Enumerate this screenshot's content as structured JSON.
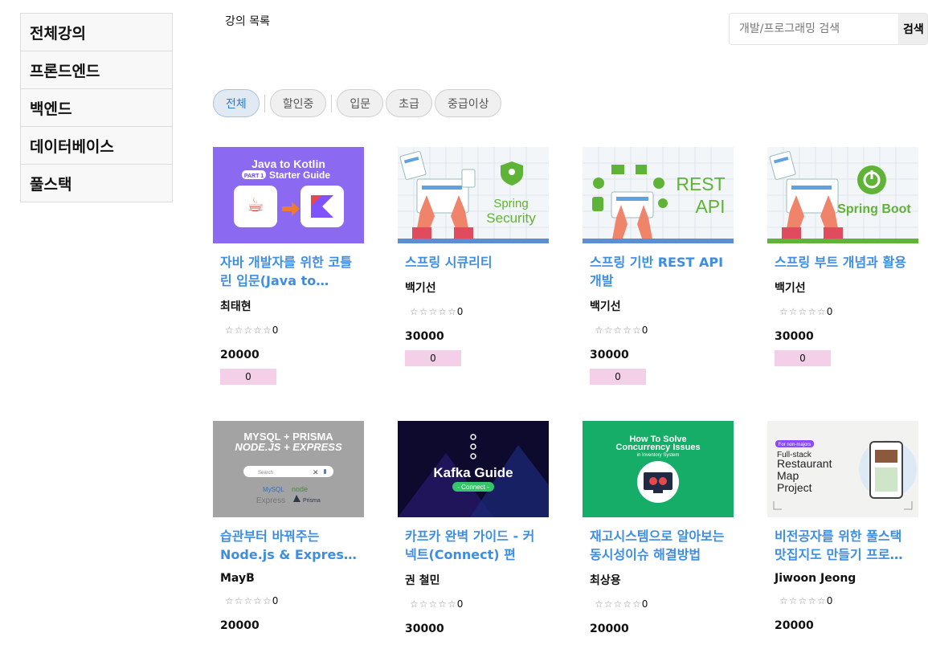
{
  "sidebar": {
    "items": [
      {
        "label": "전체강의"
      },
      {
        "label": "프론드엔드"
      },
      {
        "label": "백엔드"
      },
      {
        "label": "데이터베이스"
      },
      {
        "label": "풀스택"
      }
    ]
  },
  "page_heading": "강의 목록",
  "search": {
    "placeholder": "개발/프로그래밍 검색",
    "button_label": "검색"
  },
  "filters": [
    {
      "label": "전체",
      "active": true
    },
    {
      "label": "할인중"
    },
    {
      "label": "입문"
    },
    {
      "label": "초급"
    },
    {
      "label": "중급이상"
    }
  ],
  "courses": [
    {
      "title": "자바 개발자를 위한 코틀린 입문(Java to Kotlin Starter Guide)",
      "author": "최태현",
      "rating_count": "0",
      "price": "20000",
      "discount": "0",
      "thumb": {
        "line1": "Java to Kotlin",
        "part": "PART 1",
        "line2": "Starter Guide"
      }
    },
    {
      "title": "스프링 시큐리티",
      "author": "백기선",
      "rating_count": "0",
      "price": "30000",
      "discount": "0",
      "thumb": {
        "line1": "Spring",
        "line2": "Security"
      }
    },
    {
      "title": "스프링 기반 REST API 개발",
      "author": "백기선",
      "rating_count": "0",
      "price": "30000",
      "discount": "0",
      "thumb": {
        "line1": "REST",
        "line2": "API"
      }
    },
    {
      "title": "스프링 부트 개념과 활용",
      "author": "백기선",
      "rating_count": "0",
      "price": "30000",
      "discount": "0",
      "thumb": {
        "line1": "Spring Boot"
      }
    },
    {
      "title": "습관부터 바꿔주는 Node.js & Express 기초",
      "author": "MayB",
      "rating_count": "0",
      "price": "20000",
      "thumb": {
        "line1": "MYSQL + PRISMA",
        "line2": "NODE.JS + EXPRESS",
        "search": "Search",
        "logo1": "MySQL",
        "logo2": "node",
        "logo3": "Express",
        "logo4": "Prisma"
      }
    },
    {
      "title": "카프카 완벽 가이드 - 커넥트(Connect) 편",
      "author": "권 철민",
      "rating_count": "0",
      "price": "30000",
      "thumb": {
        "line1": "Kafka Guide",
        "line2": "- Connect -"
      }
    },
    {
      "title": "재고시스템으로 알아보는 동시성이슈 해결방법",
      "author": "최상용",
      "rating_count": "0",
      "price": "20000",
      "thumb": {
        "line1": "How To Solve",
        "line2": "Concurrency Issues",
        "line3": "in Inventory System"
      }
    },
    {
      "title": "비전공자를 위한 풀스택 맛집지도 만들기 프로젝트",
      "author": "Jiwoon Jeong",
      "rating_count": "0",
      "price": "20000",
      "thumb": {
        "tag": "For non-majors",
        "line1": "Full-stack",
        "line2": "Restaurant",
        "line3": "Map",
        "line4": "Project"
      }
    }
  ],
  "colors": {
    "title_blue": "#3d8ee3",
    "discount_badge": "#f4cfe8",
    "chip_active": "#2d7ad0"
  }
}
